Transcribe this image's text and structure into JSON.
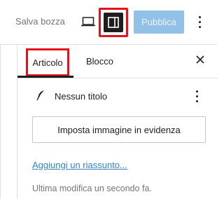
{
  "toolbar": {
    "save_draft_label": "Salva bozza",
    "preview_icon": "laptop-icon",
    "sidebar_toggle_icon": "sidebar-panel-icon",
    "publish_label": "Pubblica",
    "options_icon": "kebab-menu-icon"
  },
  "sidebar": {
    "tabs": [
      {
        "label": "Articolo",
        "active": true
      },
      {
        "label": "Blocco",
        "active": false
      }
    ],
    "close_icon": "close-icon",
    "post": {
      "icon": "feather-icon",
      "title": "Nessun titolo",
      "menu_icon": "kebab-menu-icon"
    },
    "featured_image_button": "Imposta immagine in evidenza",
    "excerpt_link": "Aggiungi un riassunto...",
    "last_modified": "Ultima modifica un secondo fa."
  },
  "colors": {
    "highlight": "#e8101a",
    "publish_bg": "#3a8fd4",
    "link": "#3582c4",
    "dark": "#1e1e1e",
    "muted": "#757575"
  }
}
